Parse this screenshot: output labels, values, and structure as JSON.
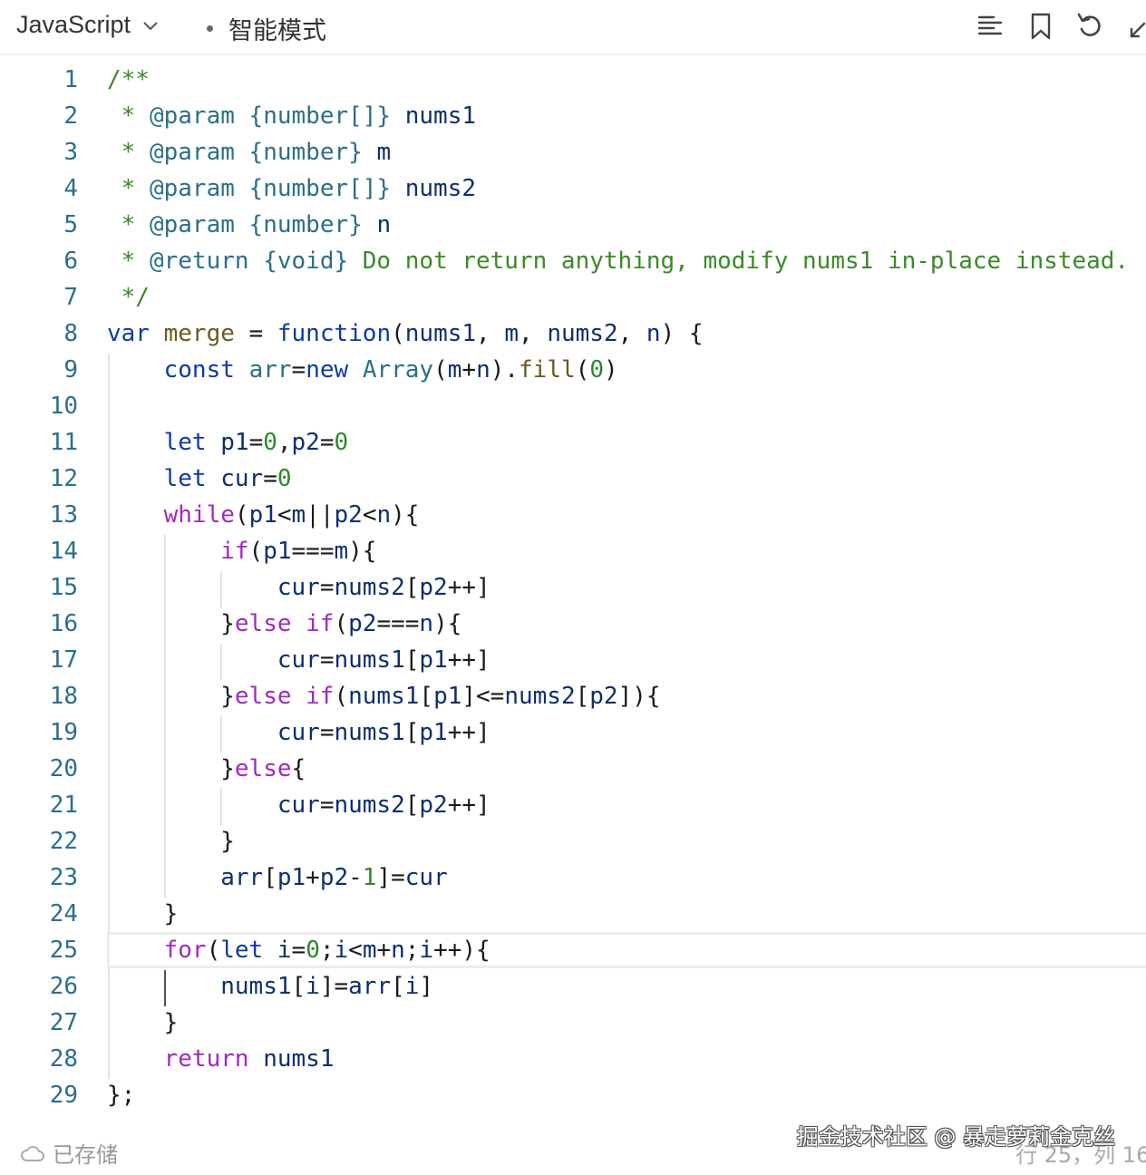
{
  "header": {
    "language": "JavaScript",
    "mode": "智能模式",
    "icons": [
      "format-icon",
      "bookmark-icon",
      "undo-icon",
      "expand-icon"
    ]
  },
  "editor": {
    "lines": [
      {
        "n": "1",
        "tokens": [
          [
            "cm",
            "/**"
          ]
        ]
      },
      {
        "n": "2",
        "tokens": [
          [
            "cm",
            " * "
          ],
          [
            "ct",
            "@param"
          ],
          [
            "p",
            " "
          ],
          [
            "ty",
            "{number[]}"
          ],
          [
            "p",
            " "
          ],
          [
            "id",
            "nums1"
          ]
        ]
      },
      {
        "n": "3",
        "tokens": [
          [
            "cm",
            " * "
          ],
          [
            "ct",
            "@param"
          ],
          [
            "p",
            " "
          ],
          [
            "ty",
            "{number}"
          ],
          [
            "p",
            " "
          ],
          [
            "id",
            "m"
          ]
        ]
      },
      {
        "n": "4",
        "tokens": [
          [
            "cm",
            " * "
          ],
          [
            "ct",
            "@param"
          ],
          [
            "p",
            " "
          ],
          [
            "ty",
            "{number[]}"
          ],
          [
            "p",
            " "
          ],
          [
            "id",
            "nums2"
          ]
        ]
      },
      {
        "n": "5",
        "tokens": [
          [
            "cm",
            " * "
          ],
          [
            "ct",
            "@param"
          ],
          [
            "p",
            " "
          ],
          [
            "ty",
            "{number}"
          ],
          [
            "p",
            " "
          ],
          [
            "id",
            "n"
          ]
        ]
      },
      {
        "n": "6",
        "tokens": [
          [
            "cm",
            " * "
          ],
          [
            "ct",
            "@return"
          ],
          [
            "p",
            " "
          ],
          [
            "ty",
            "{void}"
          ],
          [
            "cm",
            " Do not return anything, modify nums1 in-place instead."
          ]
        ]
      },
      {
        "n": "7",
        "tokens": [
          [
            "cm",
            " */"
          ]
        ]
      },
      {
        "n": "8",
        "tokens": [
          [
            "kw",
            "var"
          ],
          [
            "p",
            " "
          ],
          [
            "fn",
            "merge"
          ],
          [
            "op",
            " = "
          ],
          [
            "kw",
            "function"
          ],
          [
            "p",
            "("
          ],
          [
            "id",
            "nums1"
          ],
          [
            "p",
            ", "
          ],
          [
            "id",
            "m"
          ],
          [
            "p",
            ", "
          ],
          [
            "id",
            "nums2"
          ],
          [
            "p",
            ", "
          ],
          [
            "id",
            "n"
          ],
          [
            "p",
            ") {"
          ]
        ]
      },
      {
        "n": "9",
        "tokens": [
          [
            "p",
            "    "
          ],
          [
            "kw",
            "const"
          ],
          [
            "p",
            " "
          ],
          [
            "ty",
            "arr"
          ],
          [
            "op",
            "="
          ],
          [
            "kw",
            "new"
          ],
          [
            "p",
            " "
          ],
          [
            "ty",
            "Array"
          ],
          [
            "p",
            "("
          ],
          [
            "id",
            "m"
          ],
          [
            "op",
            "+"
          ],
          [
            "id",
            "n"
          ],
          [
            "p",
            ")."
          ],
          [
            "fn",
            "fill"
          ],
          [
            "p",
            "("
          ],
          [
            "num",
            "0"
          ],
          [
            "p",
            ")"
          ]
        ]
      },
      {
        "n": "10",
        "tokens": []
      },
      {
        "n": "11",
        "tokens": [
          [
            "p",
            "    "
          ],
          [
            "kw",
            "let"
          ],
          [
            "p",
            " "
          ],
          [
            "id",
            "p1"
          ],
          [
            "op",
            "="
          ],
          [
            "num",
            "0"
          ],
          [
            "p",
            ","
          ],
          [
            "id",
            "p2"
          ],
          [
            "op",
            "="
          ],
          [
            "num",
            "0"
          ]
        ]
      },
      {
        "n": "12",
        "tokens": [
          [
            "p",
            "    "
          ],
          [
            "kw",
            "let"
          ],
          [
            "p",
            " "
          ],
          [
            "id",
            "cur"
          ],
          [
            "op",
            "="
          ],
          [
            "num",
            "0"
          ]
        ]
      },
      {
        "n": "13",
        "tokens": [
          [
            "p",
            "    "
          ],
          [
            "ctl",
            "while"
          ],
          [
            "p",
            "("
          ],
          [
            "id",
            "p1"
          ],
          [
            "op",
            "<"
          ],
          [
            "id",
            "m"
          ],
          [
            "op",
            "||"
          ],
          [
            "id",
            "p2"
          ],
          [
            "op",
            "<"
          ],
          [
            "id",
            "n"
          ],
          [
            "p",
            "){"
          ]
        ]
      },
      {
        "n": "14",
        "tokens": [
          [
            "p",
            "        "
          ],
          [
            "ctl",
            "if"
          ],
          [
            "p",
            "("
          ],
          [
            "id",
            "p1"
          ],
          [
            "op",
            "==="
          ],
          [
            "id",
            "m"
          ],
          [
            "p",
            "){"
          ]
        ]
      },
      {
        "n": "15",
        "tokens": [
          [
            "p",
            "            "
          ],
          [
            "id",
            "cur"
          ],
          [
            "op",
            "="
          ],
          [
            "id",
            "nums2"
          ],
          [
            "p",
            "["
          ],
          [
            "id",
            "p2"
          ],
          [
            "op",
            "++"
          ],
          [
            "p",
            "]"
          ]
        ]
      },
      {
        "n": "16",
        "tokens": [
          [
            "p",
            "        }"
          ],
          [
            "ctl",
            "else if"
          ],
          [
            "p",
            "("
          ],
          [
            "id",
            "p2"
          ],
          [
            "op",
            "==="
          ],
          [
            "id",
            "n"
          ],
          [
            "p",
            "){"
          ]
        ]
      },
      {
        "n": "17",
        "tokens": [
          [
            "p",
            "            "
          ],
          [
            "id",
            "cur"
          ],
          [
            "op",
            "="
          ],
          [
            "id",
            "nums1"
          ],
          [
            "p",
            "["
          ],
          [
            "id",
            "p1"
          ],
          [
            "op",
            "++"
          ],
          [
            "p",
            "]"
          ]
        ]
      },
      {
        "n": "18",
        "tokens": [
          [
            "p",
            "        }"
          ],
          [
            "ctl",
            "else if"
          ],
          [
            "p",
            "("
          ],
          [
            "id",
            "nums1"
          ],
          [
            "p",
            "["
          ],
          [
            "id",
            "p1"
          ],
          [
            "p",
            "]"
          ],
          [
            "op",
            "<="
          ],
          [
            "id",
            "nums2"
          ],
          [
            "p",
            "["
          ],
          [
            "id",
            "p2"
          ],
          [
            "p",
            "]){"
          ]
        ]
      },
      {
        "n": "19",
        "tokens": [
          [
            "p",
            "            "
          ],
          [
            "id",
            "cur"
          ],
          [
            "op",
            "="
          ],
          [
            "id",
            "nums1"
          ],
          [
            "p",
            "["
          ],
          [
            "id",
            "p1"
          ],
          [
            "op",
            "++"
          ],
          [
            "p",
            "]"
          ]
        ]
      },
      {
        "n": "20",
        "tokens": [
          [
            "p",
            "        }"
          ],
          [
            "ctl",
            "else"
          ],
          [
            "p",
            "{"
          ]
        ]
      },
      {
        "n": "21",
        "tokens": [
          [
            "p",
            "            "
          ],
          [
            "id",
            "cur"
          ],
          [
            "op",
            "="
          ],
          [
            "id",
            "nums2"
          ],
          [
            "p",
            "["
          ],
          [
            "id",
            "p2"
          ],
          [
            "op",
            "++"
          ],
          [
            "p",
            "]"
          ]
        ]
      },
      {
        "n": "22",
        "tokens": [
          [
            "p",
            "        }"
          ]
        ]
      },
      {
        "n": "23",
        "tokens": [
          [
            "p",
            "        "
          ],
          [
            "id",
            "arr"
          ],
          [
            "p",
            "["
          ],
          [
            "id",
            "p1"
          ],
          [
            "op",
            "+"
          ],
          [
            "id",
            "p2"
          ],
          [
            "op",
            "-"
          ],
          [
            "num",
            "1"
          ],
          [
            "p",
            "]"
          ],
          [
            "op",
            "="
          ],
          [
            "id",
            "cur"
          ]
        ]
      },
      {
        "n": "24",
        "tokens": [
          [
            "p",
            "    }"
          ]
        ]
      },
      {
        "n": "25",
        "tokens": [
          [
            "p",
            "    "
          ],
          [
            "ctl",
            "for"
          ],
          [
            "p",
            "("
          ],
          [
            "kw",
            "let"
          ],
          [
            "p",
            " "
          ],
          [
            "id",
            "i"
          ],
          [
            "op",
            "="
          ],
          [
            "num",
            "0"
          ],
          [
            "p",
            ";"
          ],
          [
            "id",
            "i"
          ],
          [
            "op",
            "<"
          ],
          [
            "id",
            "m"
          ],
          [
            "op",
            "+"
          ],
          [
            "id",
            "n"
          ],
          [
            "p",
            ";"
          ],
          [
            "id",
            "i"
          ],
          [
            "op",
            "++"
          ],
          [
            "p",
            "){"
          ]
        ]
      },
      {
        "n": "26",
        "tokens": [
          [
            "p",
            "        "
          ],
          [
            "id",
            "nums1"
          ],
          [
            "p",
            "["
          ],
          [
            "id",
            "i"
          ],
          [
            "p",
            "]"
          ],
          [
            "op",
            "="
          ],
          [
            "id",
            "arr"
          ],
          [
            "p",
            "["
          ],
          [
            "id",
            "i"
          ],
          [
            "p",
            "]"
          ]
        ]
      },
      {
        "n": "27",
        "tokens": [
          [
            "p",
            "    }"
          ]
        ]
      },
      {
        "n": "28",
        "tokens": [
          [
            "p",
            "    "
          ],
          [
            "ctl",
            "return"
          ],
          [
            "p",
            " "
          ],
          [
            "id",
            "nums1"
          ]
        ]
      },
      {
        "n": "29",
        "tokens": [
          [
            "p",
            "};"
          ]
        ]
      }
    ],
    "current_line": "25"
  },
  "status": {
    "saved_label": "已存储",
    "watermark": "掘金技术社区 @ 暴走萝莉金克丝",
    "cursor_position": "行 25，列 16"
  }
}
